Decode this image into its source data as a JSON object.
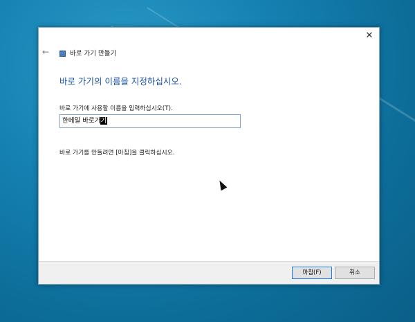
{
  "dialog": {
    "title": "바로 가기 만들기",
    "close_symbol": "✕",
    "back_symbol": "←",
    "heading": "바로 가기의 이름을 지정하십시오.",
    "prompt": "바로 가기에 사용할 이름을 입력하십시오(T).",
    "input_value_unselected": "한메일 바로가",
    "input_value_selected": "기",
    "finish_hint": "바로 가기를 만들려면 [마침]을 클릭하십시오.",
    "finish_label": "마침(F)",
    "cancel_label": "취소"
  },
  "icons": {
    "close": "close-icon",
    "back": "back-arrow-icon",
    "wizard": "shortcut-wizard-icon",
    "pointer": "mouse-pointer-icon"
  },
  "colors": {
    "heading": "#1a55a8",
    "input_border": "#7da2c8",
    "default_button_border": "#2d7bd0"
  }
}
